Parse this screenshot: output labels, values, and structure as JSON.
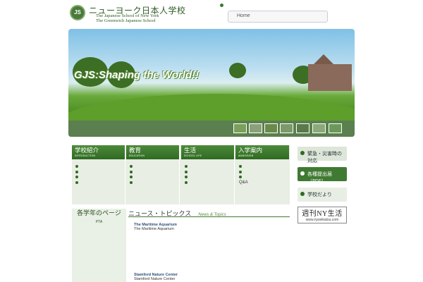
{
  "header": {
    "logo_text": "JS",
    "school_jp": "ニューヨーク日本人学校",
    "school_en_1": "The Japanese School of New York",
    "school_en_2": "The Greenwich Japanese School",
    "home_tab": "Home"
  },
  "hero": {
    "title": "GJS:Shaping the World!!",
    "thumbnails": 7
  },
  "nav": [
    {
      "jp": "学校紹介",
      "en": "INTRODUCTION",
      "items": [
        "",
        "",
        "",
        "",
        ""
      ]
    },
    {
      "jp": "教育",
      "en": "EDUCATION",
      "items": [
        "",
        "",
        "",
        ""
      ]
    },
    {
      "jp": "生活",
      "en": "SCHOOL LIFE",
      "items": [
        "",
        "",
        "",
        ""
      ]
    },
    {
      "jp": "入学案内",
      "en": "ADMISSION",
      "items": [
        "",
        "",
        "",
        "Q&A",
        ""
      ]
    }
  ],
  "sidebar": {
    "emergency": "緊急・災害時の対応",
    "forms": "各種提出届（PDF）",
    "newsletter": "学校だより",
    "weekly_title": "週刊NY生活",
    "weekly_url": "www.nyseikatsu.com"
  },
  "grade": {
    "title": "各学年のページ",
    "items": [
      "PTA"
    ]
  },
  "news": {
    "title": "ニュース・トピックス",
    "title_en": "News & Topics",
    "items": [
      {
        "title": "The Maritime Aquarium",
        "sub": "The Maritime Aquarium"
      },
      {
        "title": "Stamford Nature Center",
        "sub": "Stamford Nature Center"
      }
    ]
  },
  "colors": {
    "brand_green": "#2f6a22",
    "accent": "#3f7a32"
  }
}
